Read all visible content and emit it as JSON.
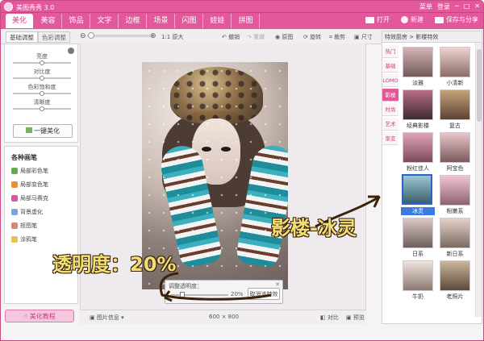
{
  "title": "美图秀秀 3.0",
  "title_buttons": [
    "菜单",
    "登录",
    "─",
    "□",
    "✕"
  ],
  "tabs": [
    "美化",
    "美容",
    "饰品",
    "文字",
    "边框",
    "场景",
    "闪图",
    "娃娃",
    "拼图"
  ],
  "top_right": {
    "open": "打开",
    "new": "新建",
    "save": "保存与分享"
  },
  "left_tabs": [
    "基础调整",
    "色彩调整"
  ],
  "toolbar": {
    "zoom_label": "1:1 原大",
    "undo": "撤销",
    "redo": "重做",
    "original": "原图",
    "rotate": "旋转",
    "crop": "裁剪",
    "size": "尺寸"
  },
  "sliders": [
    "亮度",
    "对比度",
    "色彩饱和度",
    "清晰度"
  ],
  "onekey": "一键美化",
  "pens_title": "各种画笔",
  "pens": [
    "局部彩色笔",
    "局部变色笔",
    "局部马赛克",
    "背景虚化",
    "抠图笔",
    "涂鸦笔"
  ],
  "tutorial": "美化教程",
  "opacity": {
    "label": "调整透明度：",
    "value": "20%",
    "cancel": "取消该特效"
  },
  "status": {
    "info": "图片信息",
    "size": "600 × 800",
    "compare": "对比",
    "preview": "预览"
  },
  "right_header": "特效厨房 > 影楼特效",
  "right_tabs": [
    "热门",
    "基础",
    "LOMO",
    "影楼",
    "时尚",
    "艺术",
    "渐变"
  ],
  "effects": [
    "淡雅",
    "小清新",
    "经典影楼",
    "复古",
    "粉红佳人",
    "阿宝色",
    "冰灵",
    "粉嫩系",
    "日系",
    "新日系",
    "牛奶",
    "老照片"
  ],
  "annotations": {
    "effect": "影楼-冰灵",
    "opacity": "透明度：20%"
  }
}
